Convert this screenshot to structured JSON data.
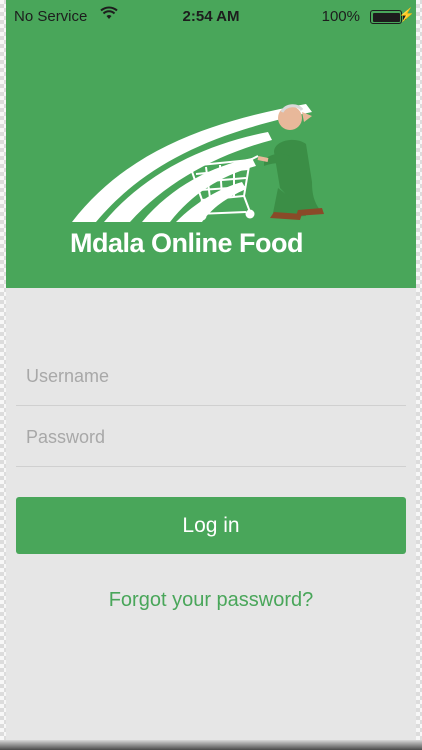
{
  "status_bar": {
    "carrier": "No Service",
    "time": "2:54 AM",
    "battery": "100%",
    "wifi_icon": "wifi-icon",
    "battery_icon": "battery-full-icon",
    "charging_icon": "charging-bolt-icon"
  },
  "banner": {
    "brand": "Mdala Online Food",
    "logo": "shopper-with-cart-logo"
  },
  "login": {
    "username_placeholder": "Username",
    "password_placeholder": "Password",
    "login_label": "Log in",
    "forgot_label": "Forgot your password?"
  },
  "colors": {
    "brand_green": "#49a65a",
    "form_background": "#e6e6e6",
    "placeholder_gray": "#a8a8a8"
  }
}
